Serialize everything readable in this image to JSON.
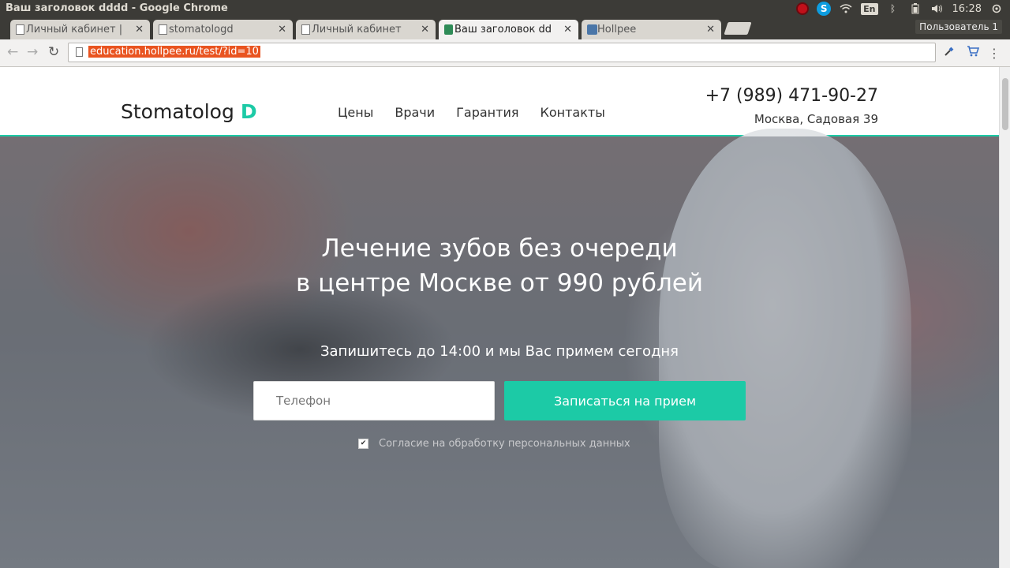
{
  "os": {
    "window_title": "Ваш заголовок dddd - Google Chrome",
    "lang": "En",
    "time": "16:28"
  },
  "browser": {
    "tabs": [
      {
        "label": "Личный кабинет |",
        "active": false
      },
      {
        "label": "stomatologd",
        "active": false
      },
      {
        "label": "Личный кабинет",
        "active": false
      },
      {
        "label": "Ваш заголовок dd",
        "active": true
      },
      {
        "label": "Hollpee",
        "active": false
      }
    ],
    "profile": "Пользователь 1",
    "url": "education.hollpee.ru/test/?id=10"
  },
  "site": {
    "logo_text": "Stomatolog",
    "logo_letter": "D",
    "nav": [
      "Цены",
      "Врачи",
      "Гарантия",
      "Контакты"
    ],
    "phone": "+7 (989) 471-90-27",
    "address": "Москва, Садовая 39",
    "accent_color": "#1ccaa6"
  },
  "hero": {
    "title_line1": "Лечение зубов без очереди",
    "title_line2": "в центре Москве от 990 рублей",
    "subtitle": "Запишитесь до 14:00 и мы Вас примем сегодня",
    "phone_placeholder": "Телефон",
    "phone_value": "",
    "cta_label": "Записаться на прием",
    "consent_label": "Согласие на обработку персональных данных",
    "consent_checked": true
  }
}
